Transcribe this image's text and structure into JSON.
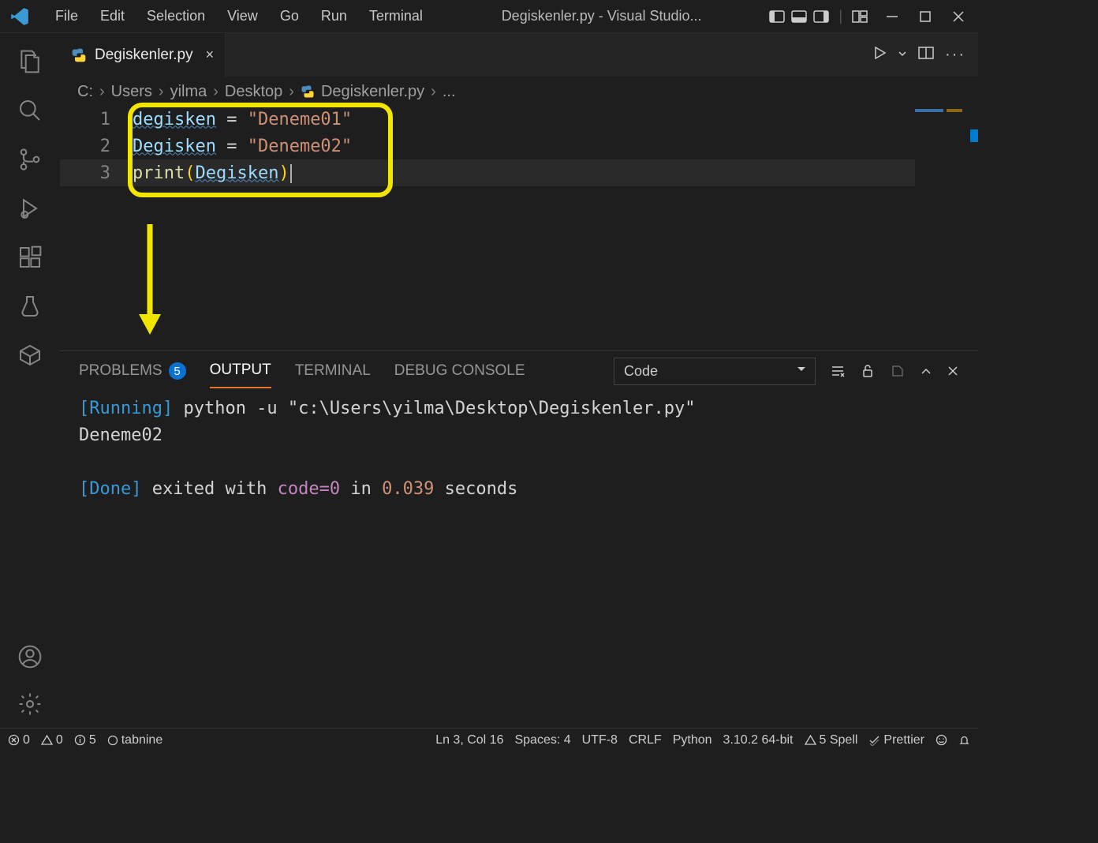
{
  "menus": [
    "File",
    "Edit",
    "Selection",
    "View",
    "Go",
    "Run",
    "Terminal"
  ],
  "window_title": "Degiskenler.py - Visual Studio...",
  "tab": {
    "name": "Degiskenler.py"
  },
  "breadcrumb": [
    "C:",
    "Users",
    "yilma",
    "Desktop",
    "Degiskenler.py",
    "..."
  ],
  "code": {
    "lines": [
      "1",
      "2",
      "3"
    ],
    "l1_var": "degisken",
    "l1_eq": " = ",
    "l1_str": "\"Deneme01\"",
    "l2_var": "Degisken",
    "l2_eq": " = ",
    "l2_str": "\"Deneme02\"",
    "l3_fn": "print",
    "l3_open": "(",
    "l3_arg": "Degisken",
    "l3_close": ")"
  },
  "panel": {
    "tabs": {
      "problems": "PROBLEMS",
      "problems_count": "5",
      "output": "OUTPUT",
      "terminal": "TERMINAL",
      "debug": "DEBUG CONSOLE"
    },
    "select": "Code"
  },
  "output": {
    "running_tag": "[Running]",
    "running_cmd": " python -u \"c:\\Users\\yilma\\Desktop\\Degiskenler.py\"",
    "result": "Deneme02",
    "done_tag": "[Done]",
    "done_a": " exited with ",
    "done_code": "code=0",
    "done_b": " in ",
    "done_time": "0.039",
    "done_c": " seconds"
  },
  "status": {
    "errors": "0",
    "warnings": "0",
    "info": "5",
    "tabnine": "tabnine",
    "pos": "Ln 3, Col 16",
    "spaces": "Spaces: 4",
    "encoding": "UTF-8",
    "eol": "CRLF",
    "lang": "Python",
    "python_ver": "3.10.2 64-bit",
    "spell": "5 Spell",
    "prettier": "Prettier"
  }
}
